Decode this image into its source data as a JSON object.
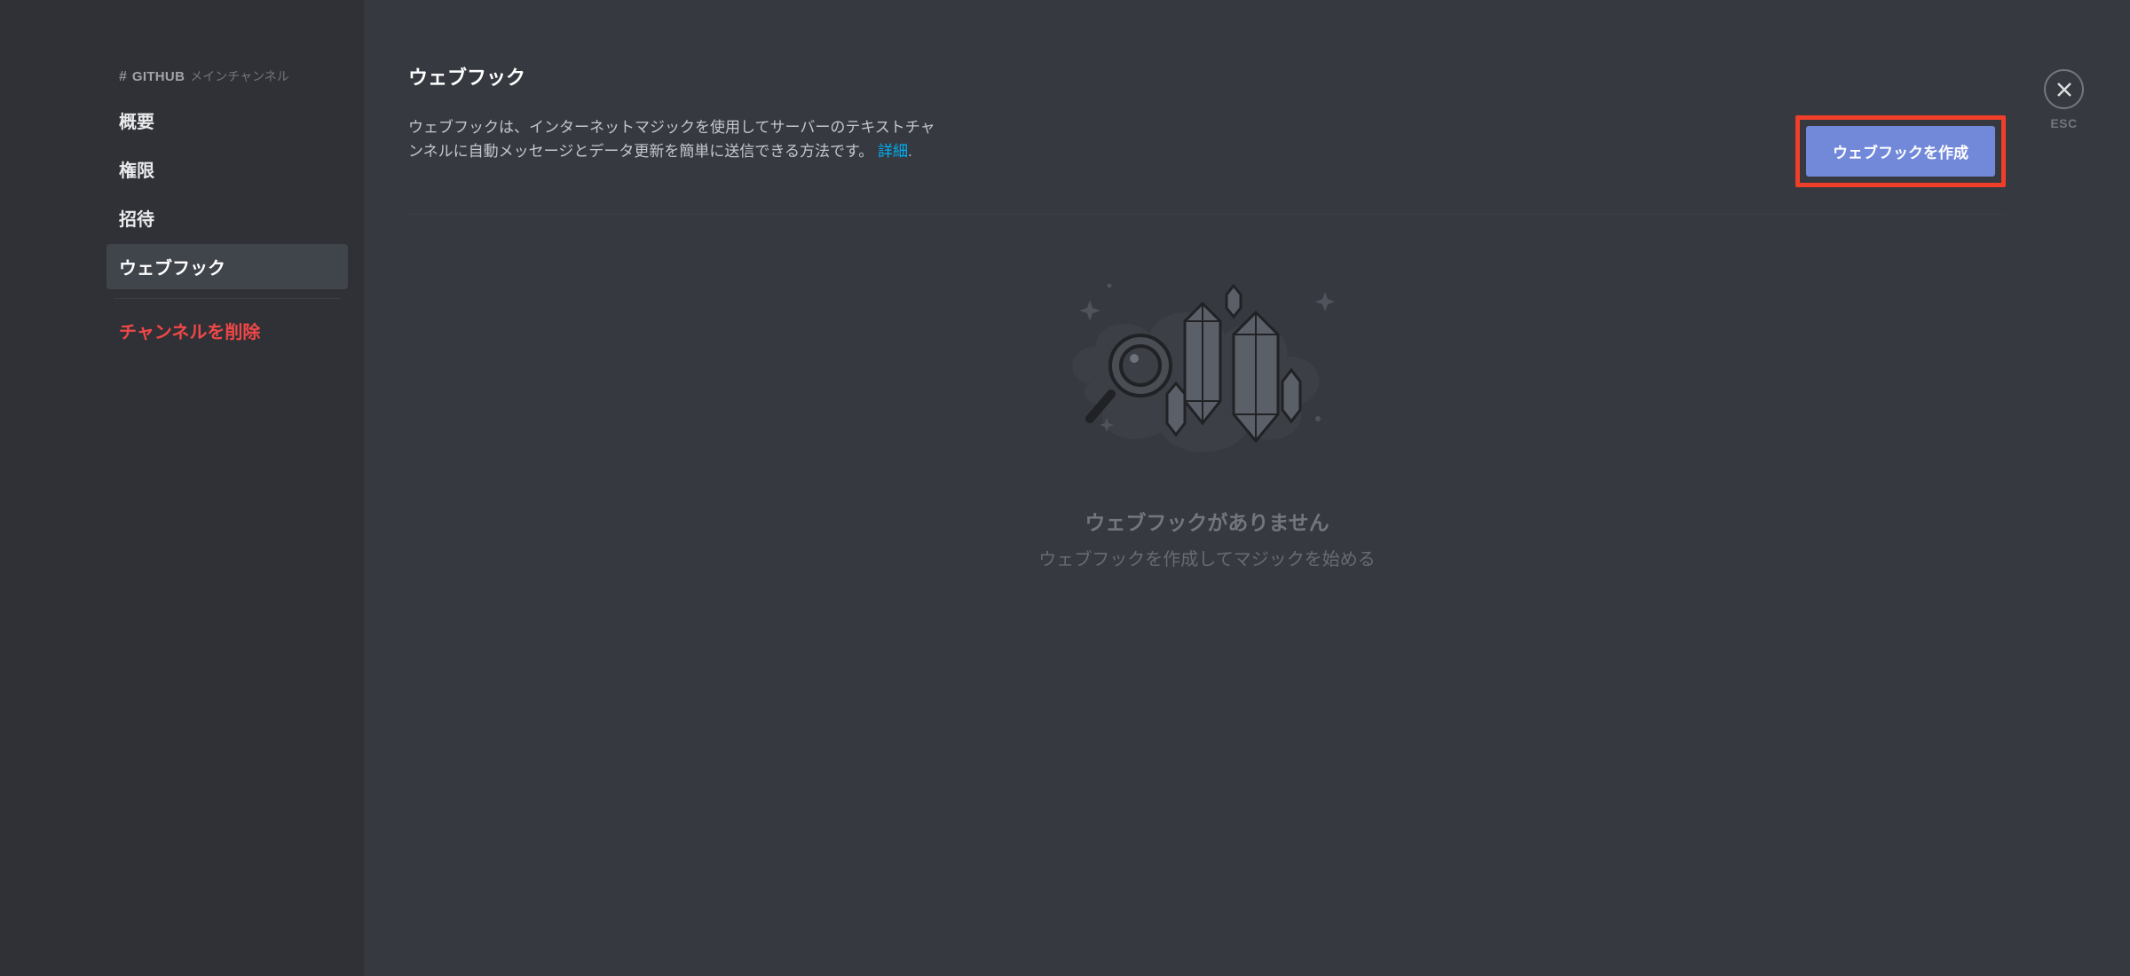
{
  "sidebar": {
    "hash": "#",
    "channel_name": "GITHUB",
    "channel_suffix": "メインチャンネル",
    "items": [
      {
        "label": "概要",
        "active": false
      },
      {
        "label": "権限",
        "active": false
      },
      {
        "label": "招待",
        "active": false
      },
      {
        "label": "ウェブフック",
        "active": true
      }
    ],
    "delete_label": "チャンネルを削除"
  },
  "main": {
    "title": "ウェブフック",
    "description_prefix": "ウェブフックは、インターネットマジックを使用してサーバーのテキストチャンネルに自動メッセージとデータ更新を簡単に送信できる方法です。",
    "description_link": "詳細",
    "description_suffix": ".",
    "create_button": "ウェブフックを作成",
    "empty_title": "ウェブフックがありません",
    "empty_sub": "ウェブフックを作成してマジックを始める"
  },
  "close": {
    "label": "ESC"
  }
}
